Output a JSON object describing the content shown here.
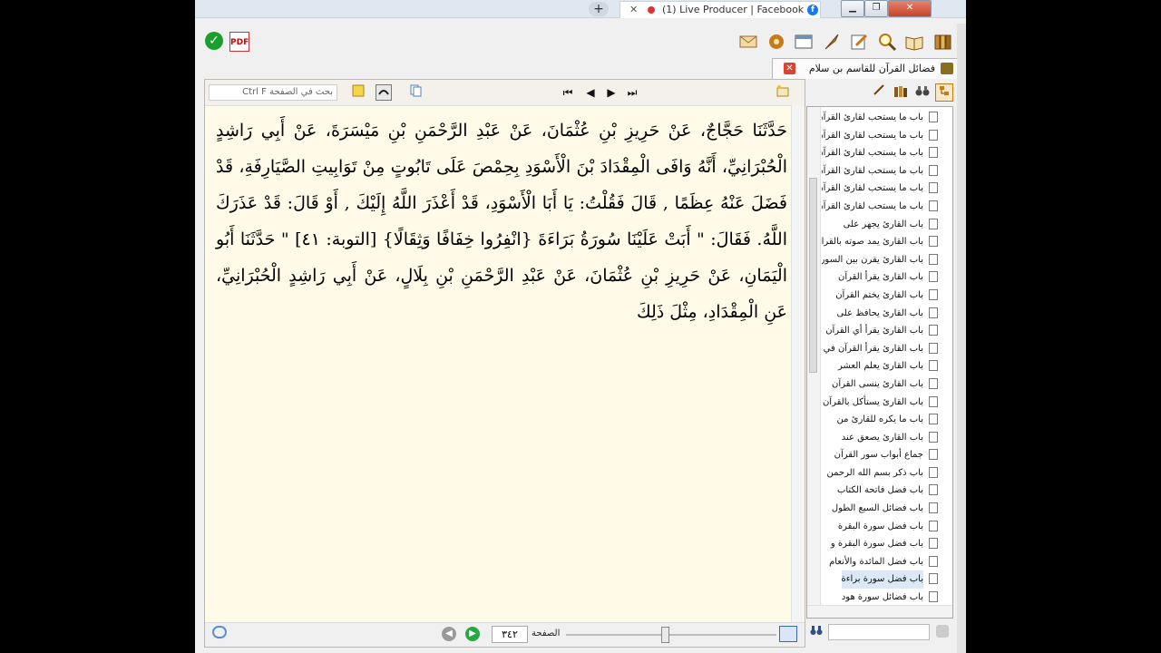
{
  "browser": {
    "new_tab": "+",
    "tab_close": "✕",
    "tab_title": "(1) Live Producer | Facebook",
    "tab_site_icon": "f",
    "window_buttons": [
      "▁",
      "❐",
      "✕"
    ]
  },
  "toolbar": {
    "ok_icon": "✓",
    "pdf_icon": "PDF"
  },
  "book_tab": {
    "title": "فضائل القرآن للقاسم بن سلام",
    "close": "✕"
  },
  "reader": {
    "search_placeholder": "بحث في الصفحة  Ctrl F",
    "nav": [
      "⏮",
      "◀",
      "▶",
      "⏭"
    ],
    "paragraph": "حَدَّثَنَا حَجَّاجٌ، عَنْ حَرِيزِ بْنِ عُثْمَانَ، عَنْ عَبْدِ الرَّحْمَنِ بْنِ مَيْسَرَةَ، عَنْ أَبِي رَاشِدٍ الْحُبْرَانِيِّ، أَنَّهُ وَافَى الْمِقْدَادَ بْنَ الْأَسْوَدِ بِحِمْصَ عَلَى تَابُوتٍ مِنْ تَوَابِيتِ الصَّيَارِفَةِ، قَدْ فَضَلَ عَنْهُ عِظَمًا , قَالَ فَقُلْتُ: يَا أَبَا الْأَسْوَدِ، قَدْ أَعْذَرَ اللَّهُ إِلَيْكَ , أَوْ قَالَ: قَدْ عَذَرَكَ اللَّهُ. فَقَالَ: \" أَبَتْ عَلَيْنَا سُورَةُ بَرَاءَةَ {انْفِرُوا خِفَافًا وَثِقَالًا} [التوبة: ٤١] \" حَدَّثَنَا أَبُو الْيَمَانِ، عَنْ حَرِيزِ بْنِ عُثْمَانَ، عَنْ عَبْدِ الرَّحْمَنِ بْنِ بِلَالٍ، عَنْ أَبِي رَاشِدٍ الْحُبْرَانِيِّ، عَنِ الْمِقْدَادِ، مِثْلَ ذَلِكَ",
    "page_label": "الصفحة",
    "page_number": "٣٤٢",
    "page_prev": "◀",
    "page_next": "▶",
    "slider_position": 0.47
  },
  "sidebar": {
    "items": [
      "باب ما يستحب لقارئ القرآن",
      "باب ما يستحب لقارئ القرآن من",
      "باب ما يستحب لقارئ القرآن",
      "باب ما يستحب لقارئ القرآن",
      "باب ما يستحب لقارئ القرآن",
      "باب ما يستحب لقارئ القرآن من",
      "باب القارئ يجهر على",
      "باب القارئ يمد صوته بالقراءة",
      "باب القارئ يقرن بين السور",
      "باب القارئ يقرأ القرآن",
      "باب القارئ يختم القرآن",
      "باب القارئ يحافظ على",
      "باب القارئ يقرأ أي القرآن",
      "باب القارئ يقرأ القرآن في",
      "باب القارئ يعلم العشر",
      "باب القارئ ينسى القرآن",
      "باب القارئ يستأكل بالقرآن",
      "باب ما يكره للقارئ من",
      "باب القارئ يصعق عند",
      "جماع أبواب سور القرآن",
      "باب ذكر بسم الله الرحمن",
      "باب فضل فاتحة الكتاب",
      "باب فضائل السبع الطول",
      "باب فضل سورة البقرة",
      "باب فضل سورة البقرة و",
      "باب فضل المائدة والأنعام",
      "باب فضل سورة براءة",
      "باب فضائل سورة هود"
    ],
    "selected_index": 26
  }
}
